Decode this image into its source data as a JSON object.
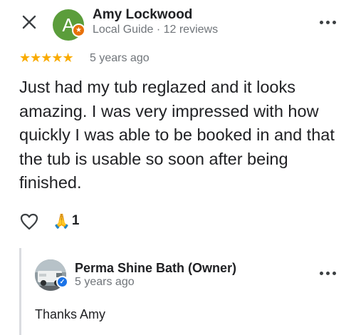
{
  "review": {
    "author_initial": "A",
    "author_name": "Amy Lockwood",
    "author_meta": "Local Guide · 12 reviews",
    "stars": "★★★★★",
    "rating": 5,
    "age": "5 years ago",
    "text": "Just had my tub reglazed and it looks amazing.  I was very impressed with how quickly I was able to be booked in and that the tub is usable so soon after being finished."
  },
  "reactions": {
    "emoji": "🙏",
    "count": "1"
  },
  "reply": {
    "owner_name": "Perma Shine Bath (Owner)",
    "age": "5 years ago",
    "text": "Thanks Amy"
  },
  "colors": {
    "avatar": "#5b9d3b",
    "badge": "#e8710a",
    "stars": "#f9ab00",
    "verified": "#1a73e8"
  },
  "icons": [
    "close-icon",
    "local-guide-badge-icon",
    "more-options-icon",
    "heart-icon",
    "praying-hands-icon",
    "verified-badge-icon"
  ]
}
